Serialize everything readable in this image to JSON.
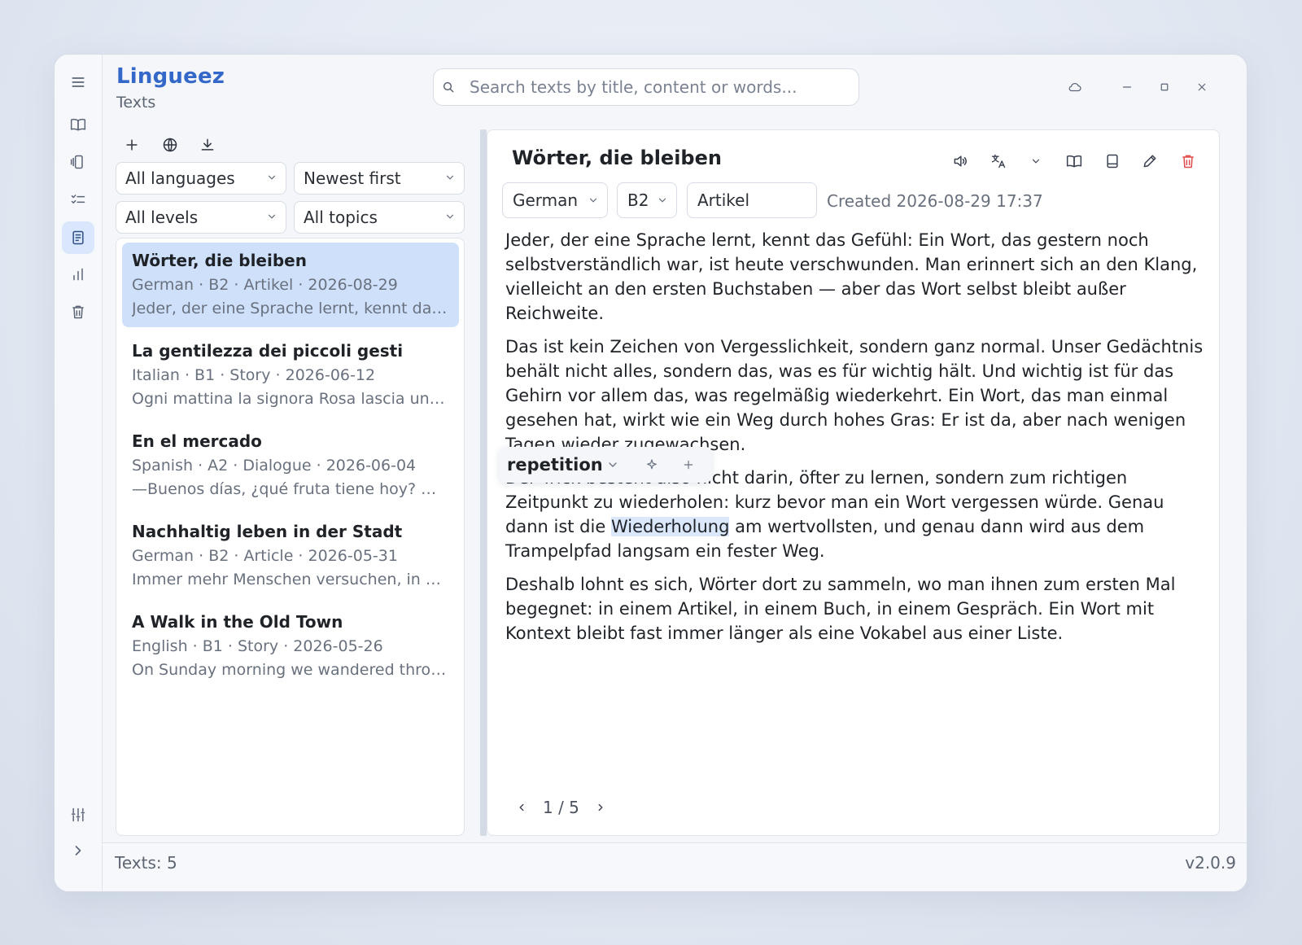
{
  "app": {
    "name": "Lingueez",
    "section": "Texts",
    "version": "v2.0.9"
  },
  "search": {
    "placeholder": "Search texts by title, content or words..."
  },
  "nav": [
    "menu-icon",
    "book-icon",
    "flashcards-icon",
    "checklist-icon",
    "texts-icon",
    "stats-icon",
    "trash-icon",
    "settings-sliders-icon",
    "expand-chevron-icon"
  ],
  "filters": {
    "language": "All languages",
    "sort": "Newest first",
    "level": "All levels",
    "topic": "All topics"
  },
  "texts": [
    {
      "title": "Wörter, die bleiben",
      "meta": "German · B2 · Artikel · 2026-08-29",
      "preview": "Jeder, der eine Sprache lernt, kennt das G..."
    },
    {
      "title": "La gentilezza dei piccoli gesti",
      "meta": "Italian · B1 · Story · 2026-06-12",
      "preview": "Ogni mattina la signora Rosa lascia un fio..."
    },
    {
      "title": "En el mercado",
      "meta": "Spanish · A2 · Dialogue · 2026-06-04",
      "preview": "—Buenos días, ¿qué fruta tiene hoy? —Te..."
    },
    {
      "title": "Nachhaltig leben in der Stadt",
      "meta": "German · B2 · Article · 2026-05-31",
      "preview": "Immer mehr Menschen versuchen, in der..."
    },
    {
      "title": "A Walk in the Old Town",
      "meta": "English · B1 · Story · 2026-05-26",
      "preview": "On Sunday morning we wandered throug..."
    }
  ],
  "detail": {
    "title": "Wörter, die bleiben",
    "language": "German",
    "level": "B2",
    "topic": "Artikel",
    "created": "Created 2026-08-29 17:37",
    "p1": "Jeder, der eine Sprache lernt, kennt das Gefühl: Ein Wort, das gestern noch selbstverständlich war, ist heute verschwunden. Man erinnert sich an den Klang, vielleicht an den ersten Buchstaben — aber das Wort selbst bleibt außer Reichweite.",
    "p2": "Das ist kein Zeichen von Vergesslichkeit, sondern ganz normal. Unser Gedächtnis behält nicht alles, sondern das, was es für wichtig hält. Und wichtig ist für das Gehirn vor allem das, was regelmäßig wiederkehrt. Ein Wort, das man einmal gesehen hat, wirkt wie ein Weg durch hohes Gras: Er ist da, aber nach wenigen Tagen wieder zugewachsen.",
    "p3_start": "Der Trick besteht also nicht darin, öfter zu lernen, sondern zum richtigen Zeitpunkt zu wiederholen: kurz bevor man ein Wort vergessen würde. Genau dann ist die ",
    "p3_highlight": "Wiederholung",
    "p3_end": " am wertvollsten, und genau dann wird aus dem Trampelpfad langsam ein fester Weg.",
    "p4": "Deshalb lohnt es sich, Wörter dort zu sammeln, wo man ihnen zum ersten Mal begegnet: in einem Artikel, in einem Buch, in einem Gespräch. Ein Wort mit Kontext bleibt fast immer länger als eine Vokabel aus einer Liste.",
    "popup_word": "repetition",
    "pager": "1 / 5"
  },
  "status": {
    "count": "Texts: 5"
  },
  "colors": {
    "accent": "#3468c8",
    "selected": "#cfe0fb",
    "highlight": "#dbe7fb",
    "danger": "#e04b4b"
  }
}
